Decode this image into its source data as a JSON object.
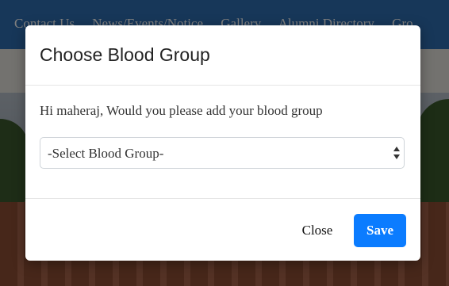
{
  "background": {
    "nav_items": [
      "Contact Us",
      "News/Events/Notice",
      "Gallery",
      "Alumni Directory",
      "Gro"
    ]
  },
  "modal": {
    "title": "Choose Blood Group",
    "message": "Hi maheraj, Would you please add your blood group",
    "select": {
      "selected_value": "-Select Blood Group-",
      "arrow_icon": "up-down-caret-icon"
    },
    "buttons": {
      "close_label": "Close",
      "save_label": "Save"
    }
  },
  "colors": {
    "nav_blue": "#2f6fb2",
    "save_button": "#0b7cff",
    "backdrop": "rgba(0,0,0,0.5)"
  }
}
